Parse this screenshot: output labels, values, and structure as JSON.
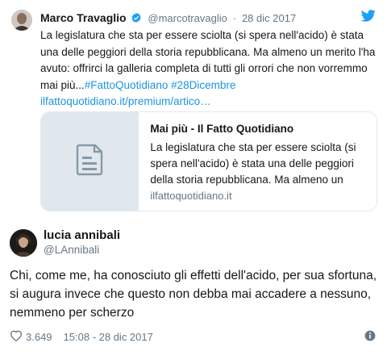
{
  "quoted_tweet": {
    "author_name": "Marco Travaglio",
    "author_handle": "@marcotravaglio",
    "separator": "·",
    "date": "28 dic 2017",
    "text": "La legislatura che sta per essere sciolta (si spera nell'acido) è stata una delle peggiori della storia repubblicana. Ma almeno un merito l'ha avuto: offrirci la galleria completa di tutti gli orrori che non vorremmo mai più...",
    "hashtag_1": "#FattoQuotidiano",
    "hashtag_2": "#28Dicembre",
    "url": "ilfattoquotidiano.it/premium/artico…",
    "icons": {
      "verified": "verified-badge-icon",
      "platform": "twitter-bird-icon"
    },
    "card": {
      "title": "Mai più - Il Fatto Quotidiano",
      "description": "La legislatura che sta per essere sciolta (si spera nell'acido) è stata una delle peggiori della storia repubblicana. Ma almeno un",
      "domain": "ilfattoquotidiano.it",
      "thumbnail_icon": "document-icon"
    }
  },
  "reply_tweet": {
    "author_name": "lucia annibali",
    "author_handle": "@LAnnibali",
    "text": "Chi, come me, ha conosciuto gli effetti dell'acido, per sua sfortuna, si augura invece che questo non debba mai accadere a nessuno, nemmeno per scherzo",
    "likes": "3.649",
    "timestamp": "15:08 - 28 dic 2017",
    "icons": {
      "like": "heart-icon",
      "info": "info-icon"
    }
  },
  "colors": {
    "link": "#1b95e0",
    "muted": "#657786",
    "border": "#e1e8ed",
    "text": "#14171a"
  }
}
